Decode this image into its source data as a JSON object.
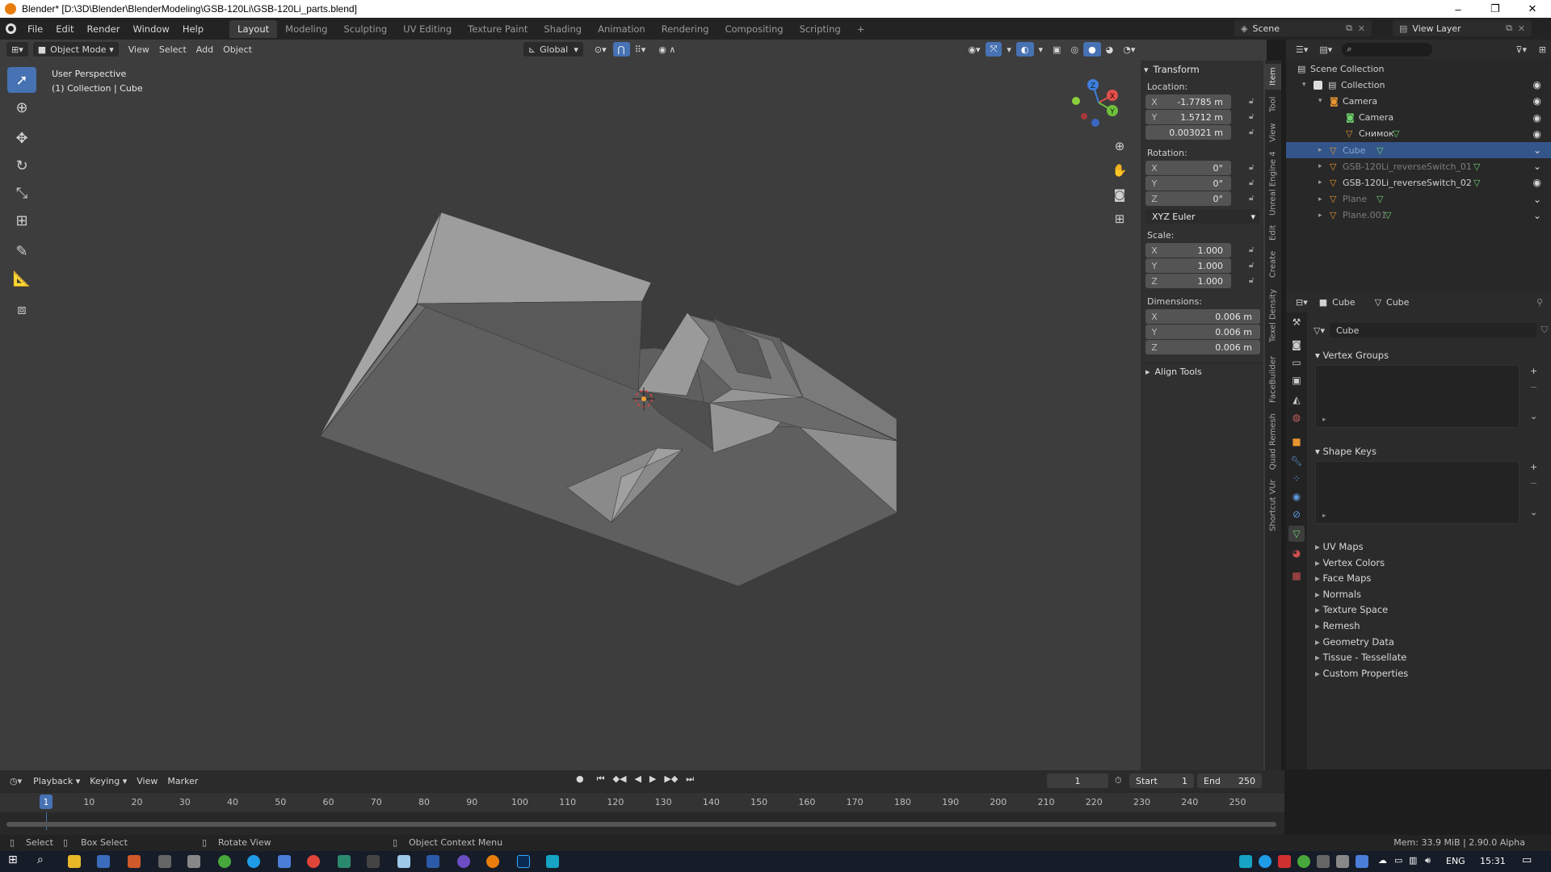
{
  "window": {
    "title": "Blender* [D:\\3D\\Blender\\BlenderModeling\\GSB-120Li\\GSB-120Li_parts.blend]",
    "minimize_glyph": "–",
    "maximize_glyph": "❐",
    "close_glyph": "✕"
  },
  "topbar": {
    "menus": [
      "File",
      "Edit",
      "Render",
      "Window",
      "Help"
    ],
    "workspaces": [
      "Layout",
      "Modeling",
      "Sculpting",
      "UV Editing",
      "Texture Paint",
      "Shading",
      "Animation",
      "Rendering",
      "Compositing",
      "Scripting"
    ],
    "active_workspace": "Layout",
    "add_workspace": "+",
    "scene": "Scene",
    "view_layer": "View Layer"
  },
  "viewport": {
    "mode": "Object Mode",
    "menus": [
      "View",
      "Select",
      "Add",
      "Object"
    ],
    "orientation": "Global",
    "info_line1": "User Perspective",
    "info_line2": "(1) Collection | Cube",
    "gizmo": {
      "x": "X",
      "y": "Y",
      "z": "Z"
    }
  },
  "npanel": {
    "tabs": [
      "Item",
      "Tool",
      "View",
      "Unreal Engine 4",
      "Edit",
      "Create",
      "Texel Density",
      "FaceBuilder",
      "Quad Remesh",
      "Shortcut VUr"
    ],
    "transform_title": "Transform",
    "location_label": "Location:",
    "location": [
      {
        "axis": "X",
        "value": "-1.7785 m"
      },
      {
        "axis": "Y",
        "value": "1.5712 m"
      },
      {
        "axis": "",
        "value": "0.003021 m"
      }
    ],
    "rotation_label": "Rotation:",
    "rotation": [
      {
        "axis": "X",
        "value": "0°"
      },
      {
        "axis": "Y",
        "value": "0°"
      },
      {
        "axis": "Z",
        "value": "0°"
      }
    ],
    "rotation_mode": "XYZ Euler",
    "scale_label": "Scale:",
    "scale": [
      {
        "axis": "X",
        "value": "1.000"
      },
      {
        "axis": "Y",
        "value": "1.000"
      },
      {
        "axis": "Z",
        "value": "1.000"
      }
    ],
    "dimensions_label": "Dimensions:",
    "dimensions": [
      {
        "axis": "X",
        "value": "0.006 m"
      },
      {
        "axis": "Y",
        "value": "0.006 m"
      },
      {
        "axis": "Z",
        "value": "0.006 m"
      }
    ],
    "align_tools": "Align Tools"
  },
  "outliner": {
    "rows": [
      {
        "label": "Scene Collection",
        "indent": 0,
        "icon": "scene-collection-icon",
        "color": "#d0d0d0"
      },
      {
        "label": "Collection",
        "indent": 1,
        "icon": "collection-icon",
        "color": "#d0d0d0"
      },
      {
        "label": "Camera",
        "indent": 2,
        "icon": "camera-object-icon",
        "color": "#d0d0d0"
      },
      {
        "label": "Camera",
        "indent": 3,
        "icon": "camera-data-icon",
        "color": "#d0d0d0"
      },
      {
        "label": "Снимок",
        "indent": 3,
        "icon": "mesh-object-icon",
        "color": "#d0d0d0"
      },
      {
        "label": "Cube",
        "indent": 2,
        "icon": "mesh-object-icon",
        "color": "#8aa6d1"
      },
      {
        "label": "GSB-120Li_reverseSwitch_01",
        "indent": 2,
        "icon": "mesh-object-icon",
        "color": "#7d7d7d"
      },
      {
        "label": "GSB-120Li_reverseSwitch_02",
        "indent": 2,
        "icon": "mesh-object-icon",
        "color": "#d0d0d0"
      },
      {
        "label": "Plane",
        "indent": 2,
        "icon": "mesh-object-icon",
        "color": "#7d7d7d"
      },
      {
        "label": "Plane.001",
        "indent": 2,
        "icon": "mesh-object-icon",
        "color": "#7d7d7d"
      }
    ]
  },
  "properties": {
    "breadcrumb_object": "Cube",
    "breadcrumb_data": "Cube",
    "mesh_name": "Cube",
    "vertex_groups": "Vertex Groups",
    "shape_keys": "Shape Keys",
    "collapsed_sections": [
      "UV Maps",
      "Vertex Colors",
      "Face Maps",
      "Normals",
      "Texture Space",
      "Remesh",
      "Geometry Data",
      "Tissue - Tessellate",
      "Custom Properties"
    ]
  },
  "timeline": {
    "menus": [
      "Playback",
      "Keying",
      "View",
      "Marker"
    ],
    "current_frame": "1",
    "start_label": "Start",
    "start": "1",
    "end_label": "End",
    "end": "250",
    "ticks": [
      "1",
      "10",
      "20",
      "30",
      "40",
      "50",
      "60",
      "70",
      "80",
      "90",
      "100",
      "110",
      "120",
      "130",
      "140",
      "150",
      "160",
      "170",
      "180",
      "190",
      "200",
      "210",
      "220",
      "230",
      "240",
      "250"
    ]
  },
  "statusbar": {
    "select": "Select",
    "box_select": "Box Select",
    "rotate_view": "Rotate View",
    "context_menu": "Object Context Menu",
    "memory": "Mem: 33.9 MiB | 2.90.0 Alpha"
  },
  "taskbar": {
    "language": "ENG",
    "time": "15:31"
  },
  "colors": {
    "accent": "#4772b3",
    "selection": "#34558a",
    "blender_orange": "#e87d0d",
    "mesh_green": "#6fd26f"
  }
}
